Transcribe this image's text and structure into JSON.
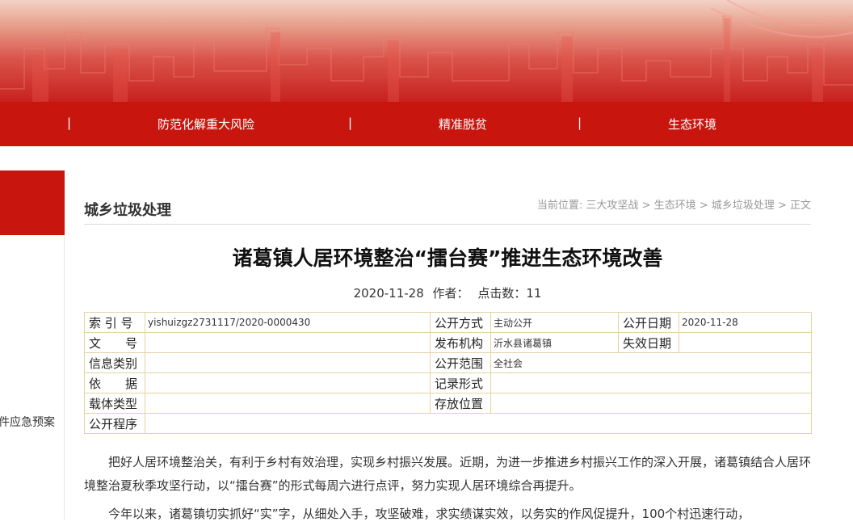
{
  "nav": {
    "items": [
      "防范化解重大风险",
      "精准脱贫",
      "生态环境"
    ],
    "separator": "|"
  },
  "sidebar": {
    "partial_text": "件应急预案"
  },
  "section": {
    "title": "城乡垃圾处理"
  },
  "breadcrumb": {
    "prefix": "当前位置:",
    "items": [
      "三大攻坚战",
      "生态环境",
      "城乡垃圾处理",
      "正文"
    ],
    "separator": ">"
  },
  "article": {
    "title": "诸葛镇人居环境整治“擂台赛”推进生态环境改善",
    "date": "2020-11-28",
    "author_label": "作者：",
    "hits_label": "点击数：",
    "hits": "11",
    "paragraphs": [
      "把好人居环境整治关，有利于乡村有效治理，实现乡村振兴发展。近期，为进一步推进乡村振兴工作的深入开展，诸葛镇结合人居环境整治夏秋季攻坚行动，以“擂台赛”的形式每周六进行点评，努力实现人居环境综合再提升。",
      "今年以来，诸葛镇切实抓好“实”字，从细处入手，攻坚破难，求实绩谋实效，以务实的作风促提升，100个村迅速行动，"
    ]
  },
  "info_table": {
    "rows": [
      [
        {
          "label": "索 引 号",
          "value": "yishuizgz2731117/2020-0000430"
        },
        {
          "label": "公开方式",
          "value": "主动公开"
        },
        {
          "label": "公开日期",
          "value": "2020-11-28"
        }
      ],
      [
        {
          "label": "文　　号",
          "value": ""
        },
        {
          "label": "发布机构",
          "value": "沂水县诸葛镇"
        },
        {
          "label": "失效日期",
          "value": ""
        }
      ],
      [
        {
          "label": "信息类别",
          "value": ""
        },
        {
          "label": "公开范围",
          "value": "全社会"
        }
      ],
      [
        {
          "label": "依　　据",
          "value": ""
        },
        {
          "label": "记录形式",
          "value": ""
        }
      ],
      [
        {
          "label": "载体类型",
          "value": ""
        },
        {
          "label": "存放位置",
          "value": ""
        }
      ],
      [
        {
          "label": "公开程序",
          "value": ""
        }
      ]
    ]
  },
  "colors": {
    "brand_red": "#c8160f",
    "table_border": "#e3d3a5"
  }
}
